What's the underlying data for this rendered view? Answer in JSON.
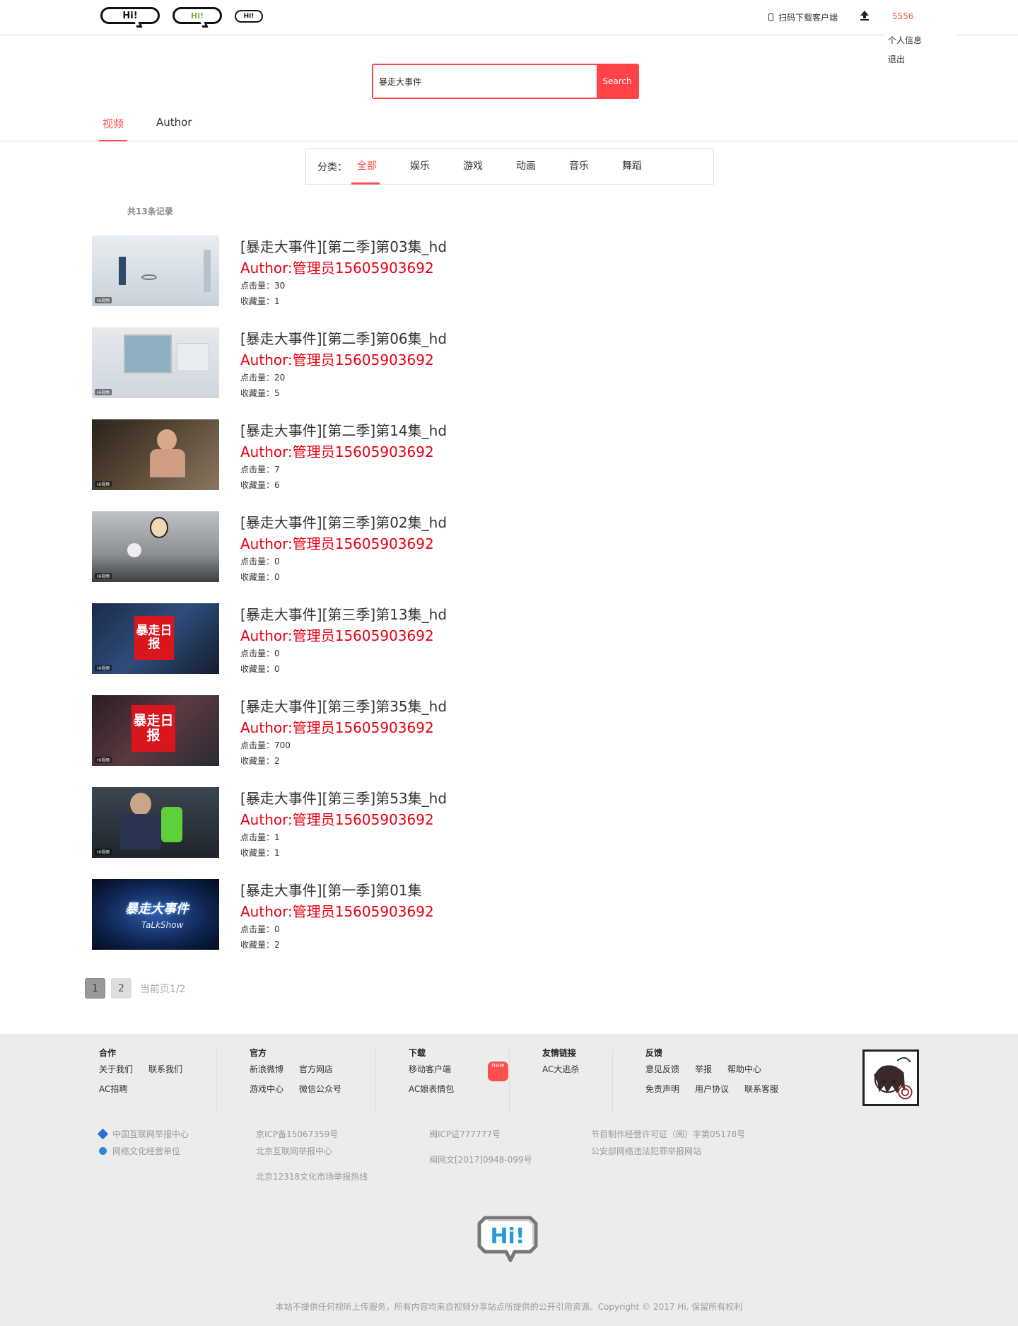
{
  "header": {
    "logo_texts": [
      "Hi!",
      "Hi!",
      "Hi!"
    ],
    "download_label": "扫码下载客户端",
    "username": "5556",
    "user_menu": [
      "个人信息",
      "退出"
    ]
  },
  "search": {
    "value": "暴走大事件",
    "button": "Search"
  },
  "tabs": [
    "视频",
    "Author"
  ],
  "categories": {
    "label": "分类：",
    "items": [
      "全部",
      "娱乐",
      "游戏",
      "动画",
      "音乐",
      "舞蹈"
    ]
  },
  "record_count": "共13条记录",
  "videos": [
    {
      "title": "[暴走大事件][第二季]第03集_hd",
      "author": "Author:管理员15605903692",
      "views": "点击量：30",
      "favs": "收藏量：1"
    },
    {
      "title": "[暴走大事件][第二季]第06集_hd",
      "author": "Author:管理员15605903692",
      "views": "点击量：20",
      "favs": "收藏量：5"
    },
    {
      "title": "[暴走大事件][第二季]第14集_hd",
      "author": "Author:管理员15605903692",
      "views": "点击量：7",
      "favs": "收藏量：6"
    },
    {
      "title": "[暴走大事件][第三季]第02集_hd",
      "author": "Author:管理员15605903692",
      "views": "点击量：0",
      "favs": "收藏量：0"
    },
    {
      "title": "[暴走大事件][第三季]第13集_hd",
      "author": "Author:管理员15605903692",
      "views": "点击量：0",
      "favs": "收藏量：0"
    },
    {
      "title": "[暴走大事件][第三季]第35集_hd",
      "author": "Author:管理员15605903692",
      "views": "点击量：700",
      "favs": "收藏量：2"
    },
    {
      "title": "[暴走大事件][第三季]第53集_hd",
      "author": "Author:管理员15605903692",
      "views": "点击量：1",
      "favs": "收藏量：1"
    },
    {
      "title": "[暴走大事件][第一季]第01集",
      "author": "Author:管理员15605903692",
      "views": "点击量：0",
      "favs": "收藏量：2"
    }
  ],
  "thumb_texts": [
    "暴走日报",
    "暴走日报",
    "暴走大事件",
    "TaLkShow"
  ],
  "pager": {
    "pages": [
      "1",
      "2"
    ],
    "info": "当前页1/2"
  },
  "footer": {
    "cols": [
      {
        "title": "合作",
        "rows": [
          [
            "关于我们",
            "联系我们"
          ],
          [
            "AC招聘"
          ]
        ]
      },
      {
        "title": "官方",
        "rows": [
          [
            "新浪微博",
            "官方网店"
          ],
          [
            "游戏中心",
            "微信公众号"
          ]
        ]
      },
      {
        "title": "下载",
        "rows": [
          [
            "移动客户端"
          ],
          [
            "AC娘表情包"
          ]
        ],
        "badge": "new"
      },
      {
        "title": "友情链接",
        "rows": [
          [
            "AC大逃杀"
          ]
        ]
      },
      {
        "title": "反馈",
        "rows": [
          [
            "意见反馈",
            "举报",
            "帮助中心"
          ],
          [
            "免责声明",
            "用户协议",
            "联系客服"
          ]
        ]
      }
    ],
    "lic1": [
      "中国互联网举报中心",
      "网络文化经营单位"
    ],
    "lic2": [
      "京ICP备15067359号",
      "北京互联网举报中心",
      "北京12318文化市场举报热线"
    ],
    "lic3": [
      "闽ICP证777777号",
      "闽网文[2017]0948-099号"
    ],
    "lic4": [
      "节目制作经营许可证（闽）字第05178号",
      "公安部网络违法犯罪举报网站"
    ],
    "copyright": "本站不提供任何视听上传服务，所有内容均来自视频分享站点所提供的公开引用资源。Copyright © 2017 Hi. 保留所有权利"
  }
}
